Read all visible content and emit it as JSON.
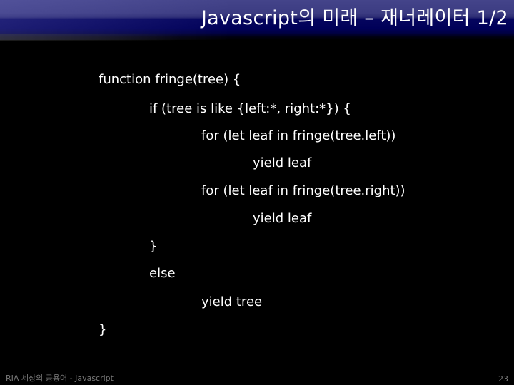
{
  "slide": {
    "title": "Javascript의 미래 – 재너레이터 1/2",
    "code_lines": [
      {
        "indent": 0,
        "text": "function fringe(tree) {"
      },
      {
        "indent": 1,
        "text": "if (tree is like {left:*, right:*}) {"
      },
      {
        "indent": 2,
        "text": "for (let leaf in fringe(tree.left))"
      },
      {
        "indent": 3,
        "text": "yield leaf"
      },
      {
        "indent": 2,
        "text": "for (let leaf in fringe(tree.right))"
      },
      {
        "indent": 3,
        "text": "yield leaf"
      },
      {
        "indent": 1,
        "text": "}"
      },
      {
        "indent": 1,
        "text": "else"
      },
      {
        "indent": 2,
        "text": "yield tree"
      },
      {
        "indent": 0,
        "text": "}"
      }
    ]
  },
  "footer": {
    "left_text": "RIA 세상의 공용어 - Javascript",
    "page_number": "23"
  },
  "colors": {
    "background": "#000000",
    "header_navy": "#000058",
    "header_top": "#44448a",
    "text": "#ffffff",
    "footer_text": "#7a7a7a"
  }
}
